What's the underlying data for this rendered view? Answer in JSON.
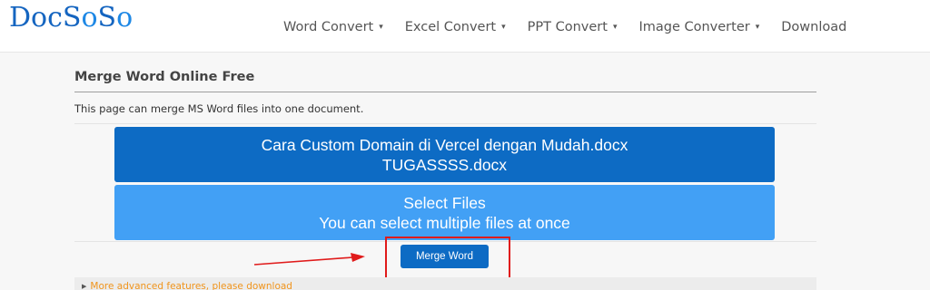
{
  "header": {
    "logo": {
      "text_prefix": "Doc",
      "s1": "S",
      "o1": "o",
      "s2": "S",
      "o2": "o"
    },
    "nav": [
      {
        "label": "Word Convert",
        "has_dropdown": true
      },
      {
        "label": "Excel Convert",
        "has_dropdown": true
      },
      {
        "label": "PPT Convert",
        "has_dropdown": true
      },
      {
        "label": "Image Converter",
        "has_dropdown": true
      },
      {
        "label": "Download",
        "has_dropdown": false
      }
    ],
    "caret": "▾"
  },
  "main": {
    "title": "Merge Word Online Free",
    "description": "This page can merge MS Word files into one document.",
    "files": [
      "Cara Custom Domain di Vercel dengan Mudah.docx",
      "TUGASSSS.docx"
    ],
    "select": {
      "line1": "Select Files",
      "line2": "You can select multiple files at once"
    },
    "merge_button": "Merge Word",
    "advanced": {
      "arrow": "▶",
      "label": "More advanced features, please download"
    }
  },
  "annotation": {
    "color": "#e01b1b"
  },
  "colors": {
    "primary": "#0d6bc4",
    "select": "#42a0f5",
    "link": "#f0941c"
  }
}
